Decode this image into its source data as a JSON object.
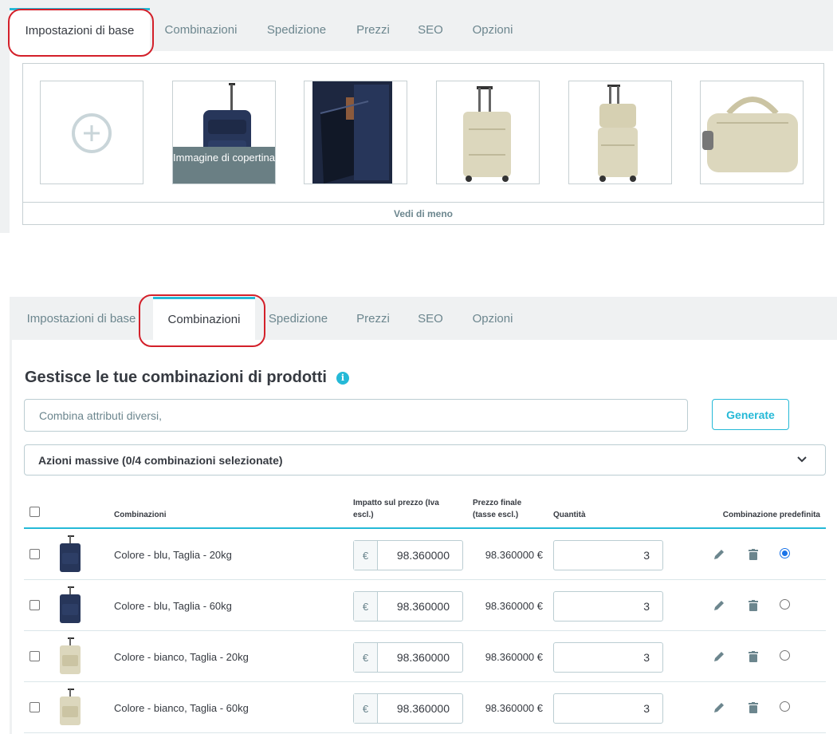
{
  "top_panel": {
    "tabs": [
      {
        "label": "Impostazioni di base",
        "active": true
      },
      {
        "label": "Combinazioni",
        "active": false
      },
      {
        "label": "Spedizione",
        "active": false
      },
      {
        "label": "Prezzi",
        "active": false
      },
      {
        "label": "SEO",
        "active": false
      },
      {
        "label": "Opzioni",
        "active": false
      }
    ],
    "gallery": {
      "add_icon": "plus-circle-icon",
      "cover_label": "Immagine di copertina",
      "images": [
        "navy-rolling-backpack",
        "navy-bag-open-pocket",
        "beige-trolley",
        "beige-trolley-with-bag",
        "beige-travel-bag"
      ],
      "see_less": "Vedi di meno"
    }
  },
  "bottom_panel": {
    "tabs": [
      {
        "label": "Impostazioni di base",
        "active": false
      },
      {
        "label": "Combinazioni",
        "active": true
      },
      {
        "label": "Spedizione",
        "active": false
      },
      {
        "label": "Prezzi",
        "active": false
      },
      {
        "label": "SEO",
        "active": false
      },
      {
        "label": "Opzioni",
        "active": false
      }
    ],
    "title": "Gestisce le tue combinazioni di prodotti",
    "info_icon": "i",
    "attributes_input": {
      "placeholder": "Combina attributi diversi,",
      "value": ""
    },
    "generate_label": "Generate",
    "bulk_actions": "Azioni massive (0/4 combinazioni selezionate)",
    "table": {
      "headers": {
        "combinations": "Combinazioni",
        "price_impact_line1": "Impatto sul prezzo (Iva",
        "price_impact_line2": "escl.)",
        "final_price_line1": "Prezzo finale",
        "final_price_line2": "(tasse escl.)",
        "quantity": "Quantità",
        "default": "Combinazione predefinita"
      },
      "currency": "€",
      "rows": [
        {
          "name": "Colore - blu, Taglia - 20kg",
          "impact": "98.360000",
          "final": "98.360000 €",
          "qty": "3",
          "default": true,
          "color": "blue"
        },
        {
          "name": "Colore - blu, Taglia - 60kg",
          "impact": "98.360000",
          "final": "98.360000 €",
          "qty": "3",
          "default": false,
          "color": "blue"
        },
        {
          "name": "Colore - bianco, Taglia - 20kg",
          "impact": "98.360000",
          "final": "98.360000 €",
          "qty": "3",
          "default": false,
          "color": "beige"
        },
        {
          "name": "Colore - bianco, Taglia - 60kg",
          "impact": "98.360000",
          "final": "98.360000 €",
          "qty": "3",
          "default": false,
          "color": "beige"
        }
      ]
    }
  },
  "colors": {
    "accent": "#25b9d7",
    "highlight": "#d3202a",
    "tab_bar": "#eff1f2"
  }
}
